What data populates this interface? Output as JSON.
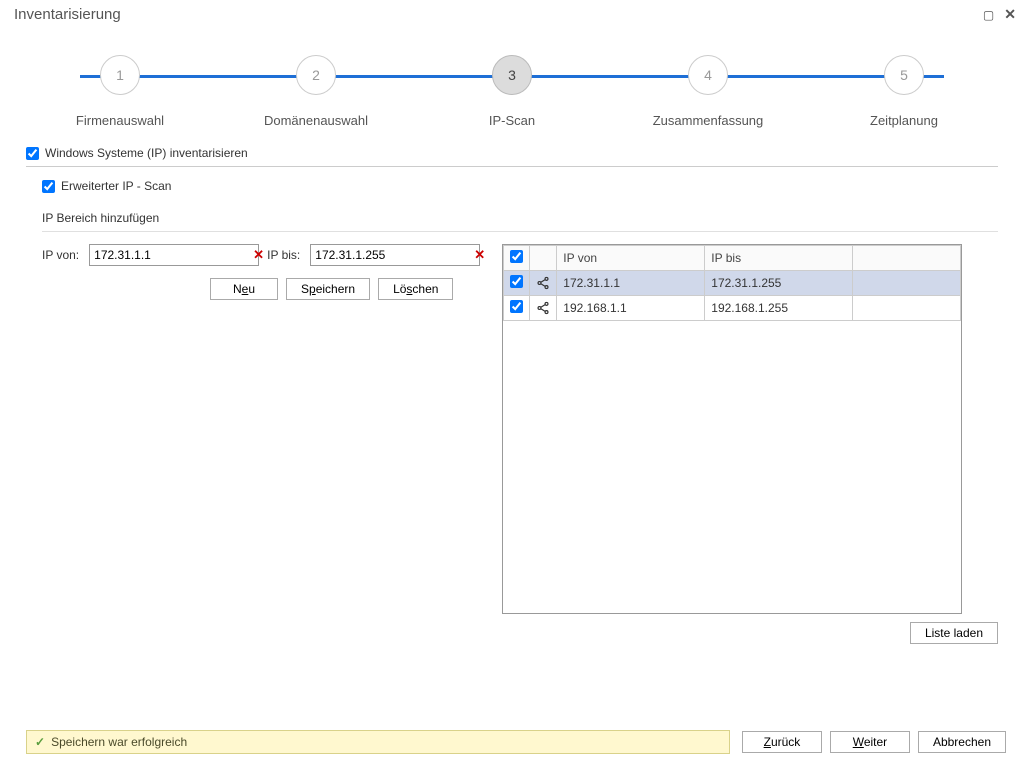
{
  "window": {
    "title": "Inventarisierung"
  },
  "steps": [
    {
      "num": "1",
      "label": "Firmenauswahl"
    },
    {
      "num": "2",
      "label": "Domänenauswahl"
    },
    {
      "num": "3",
      "label": "IP-Scan"
    },
    {
      "num": "4",
      "label": "Zusammenfassung"
    },
    {
      "num": "5",
      "label": "Zeitplanung"
    }
  ],
  "checkboxes": {
    "inventory_windows": "Windows Systeme (IP) inventarisieren",
    "extended_scan": "Erweiterter IP - Scan"
  },
  "range": {
    "title": "IP Bereich hinzufügen",
    "from_label": "IP von:",
    "to_label": "IP bis:",
    "from_value": "172.31.1.1",
    "to_value": "172.31.1.255"
  },
  "buttons": {
    "new": "Neu",
    "save": "Speichern",
    "delete": "Löschen",
    "load_list": "Liste laden",
    "back": "Zurück",
    "next": "Weiter",
    "cancel": "Abbrechen"
  },
  "table": {
    "headers": {
      "chk": "✓",
      "ip_from": "IP von",
      "ip_to": "IP bis"
    },
    "rows": [
      {
        "checked": true,
        "from": "172.31.1.1",
        "to": "172.31.1.255",
        "selected": true
      },
      {
        "checked": true,
        "from": "192.168.1.1",
        "to": "192.168.1.255",
        "selected": false
      }
    ]
  },
  "status": {
    "message": "Speichern war erfolgreich"
  }
}
